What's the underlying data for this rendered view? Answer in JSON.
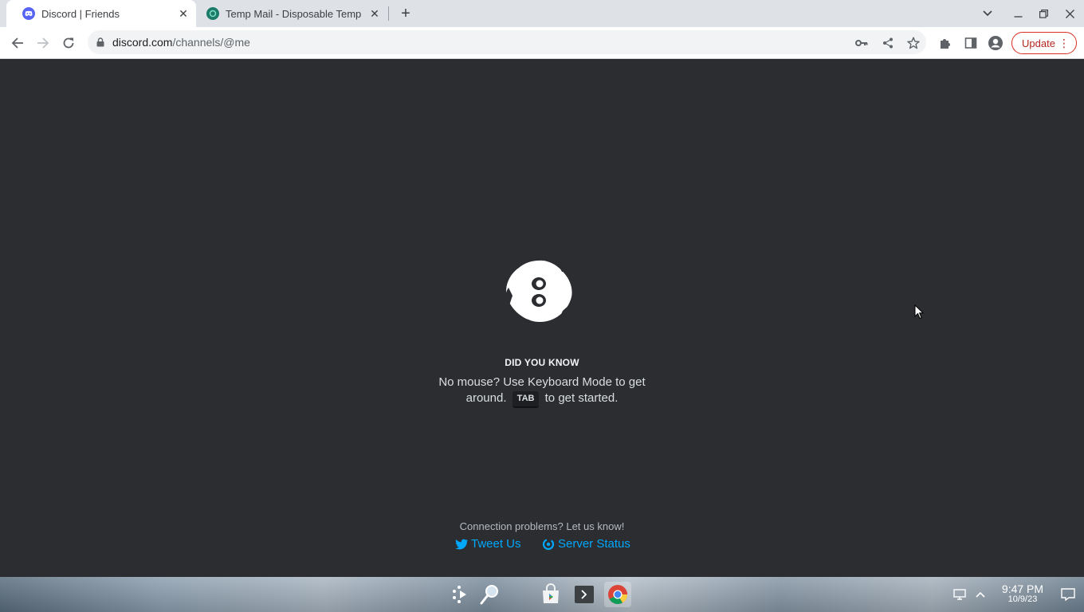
{
  "browser": {
    "tabs": [
      {
        "title": "Discord | Friends",
        "active": true,
        "favicon": "discord-icon"
      },
      {
        "title": "Temp Mail - Disposable Temp",
        "active": false,
        "favicon": "tempmail-icon"
      }
    ],
    "url_host": "discord.com",
    "url_path": "/channels/@me",
    "update_label": "Update",
    "colors": {
      "update": "#d93025",
      "discord_blurple": "#5865f2"
    }
  },
  "page": {
    "did_you_know": "DID YOU KNOW",
    "tip_before": "No mouse? Use Keyboard Mode to get around.",
    "tip_key": "TAB",
    "tip_after": "to get started.",
    "connection_text": "Connection problems? Let us know!",
    "tweet_label": "Tweet Us",
    "status_label": "Server Status",
    "colors": {
      "background": "#2b2d31",
      "link": "#00a8fc"
    }
  },
  "taskbar": {
    "apps": [
      "launcher-icon",
      "search-icon",
      "store-icon",
      "terminal-icon",
      "chrome-icon"
    ],
    "time": "9:47 PM",
    "date": "10/9/23"
  }
}
